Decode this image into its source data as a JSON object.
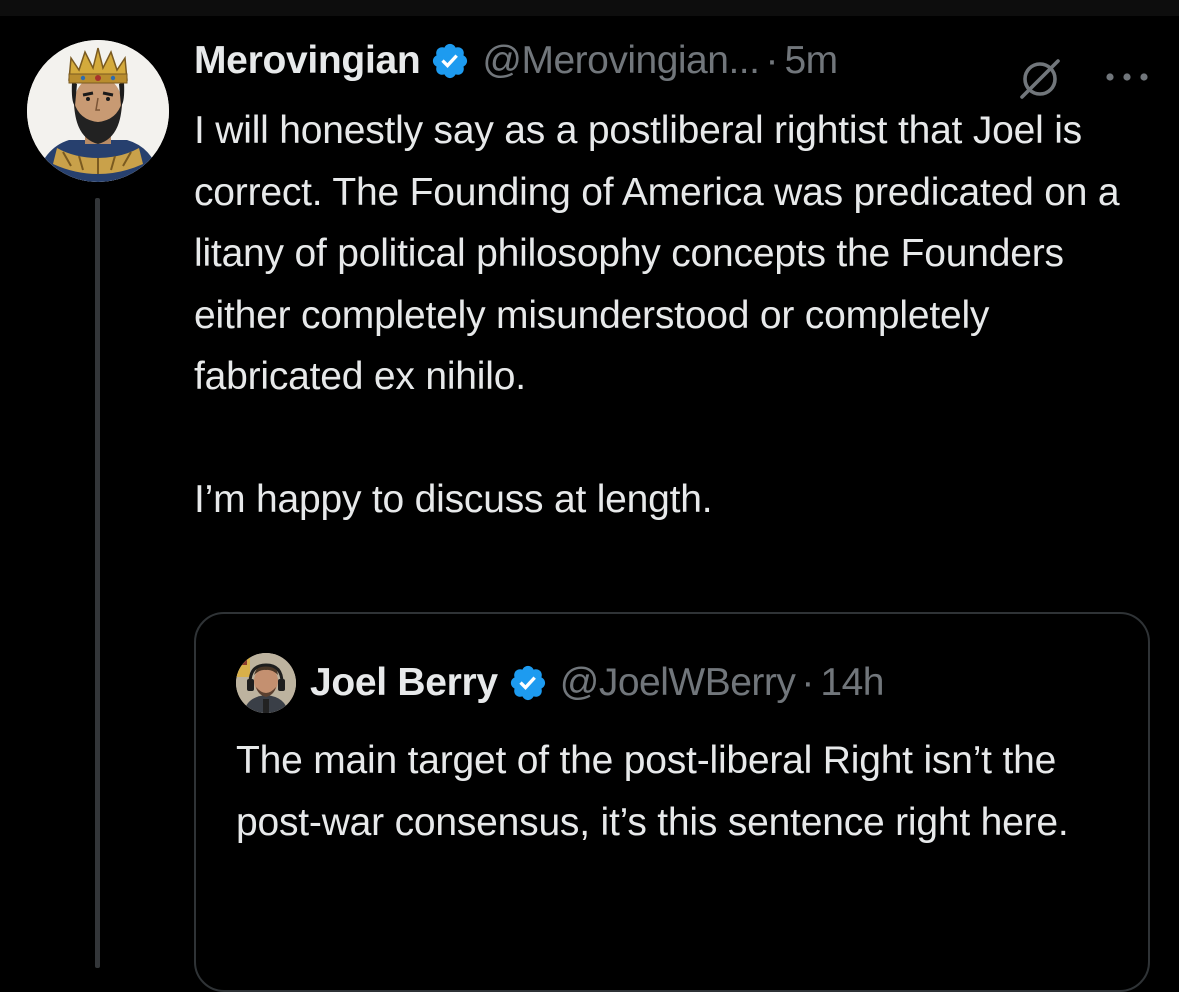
{
  "tweet": {
    "author": {
      "display_name": "Merovingian",
      "handle": "@Merovingian...",
      "verified": true
    },
    "separator": "·",
    "time": "5m",
    "text_paragraphs": [
      "I will honestly say as a postliberal rightist that Joel is correct. The Founding of America was predicated on a litany of political philosophy concepts the Founders either completely misunderstood or completely fabricated ex nihilo.",
      "I’m happy to discuss at length."
    ],
    "icons": [
      "grok-icon",
      "more-icon",
      "verified-badge-icon"
    ]
  },
  "quote": {
    "author": {
      "display_name": "Joel Berry",
      "handle": "@JoelWBerry",
      "verified": true
    },
    "separator": "·",
    "time": "14h",
    "text": "The main target of the post-liberal Right isn’t the post-war consensus, it’s this sentence right here."
  },
  "colors": {
    "background": "#000000",
    "primary_text": "#e7e9ea",
    "secondary_text": "#71767b",
    "verified_blue": "#1d9bf0",
    "border": "#2f3336",
    "thread_line": "#333639"
  }
}
